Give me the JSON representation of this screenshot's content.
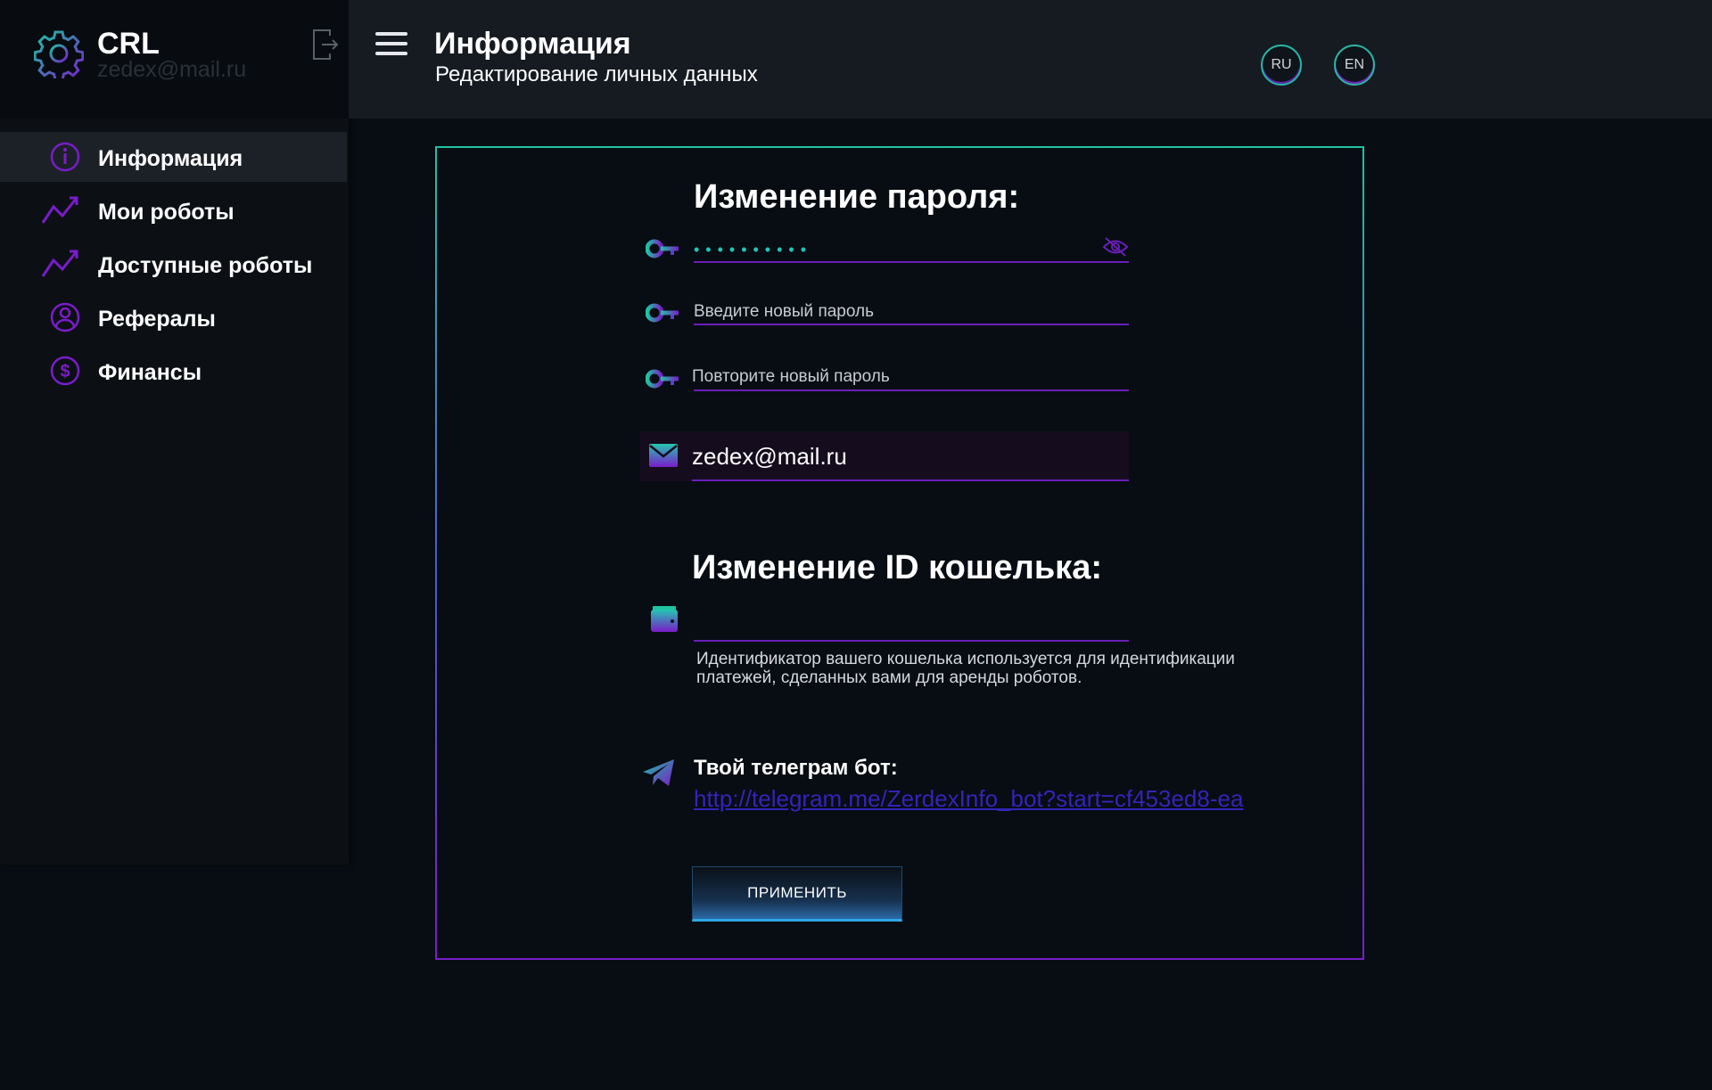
{
  "brand": {
    "name": "CRL",
    "email": "zedex@mail.ru"
  },
  "sidebar": {
    "items": [
      {
        "label": "Информация",
        "icon": "info-icon",
        "active": true
      },
      {
        "label": "Мои роботы",
        "icon": "trend-icon",
        "active": false
      },
      {
        "label": "Доступные роботы",
        "icon": "trend-icon",
        "active": false
      },
      {
        "label": "Рефералы",
        "icon": "user-icon",
        "active": false
      },
      {
        "label": "Финансы",
        "icon": "dollar-icon",
        "active": false
      }
    ]
  },
  "header": {
    "title": "Информация",
    "subtitle": "Редактирование личных данных",
    "languages": [
      "RU",
      "EN"
    ]
  },
  "form": {
    "password_section_title": "Изменение пароля:",
    "current_password_mask": "••••••••••",
    "new_password_placeholder": "Введите новый пароль",
    "repeat_password_placeholder": "Повторите новый пароль",
    "email_value": "zedex@mail.ru",
    "wallet_section_title": "Изменение ID кошелька:",
    "wallet_value": "",
    "wallet_help": "Идентификатор вашего кошелька используется для идентификации платежей, сделанных вами для аренды роботов.",
    "telegram_title": "Твой телеграм бот:",
    "telegram_link": "http://telegram.me/ZerdexInfo_bot?start=cf453ed8-ea",
    "apply_label": "ПРИМЕНИТЬ"
  },
  "colors": {
    "accent_teal": "#1ec3a3",
    "accent_purple": "#7a1cc9",
    "link": "#3324b8",
    "background": "#070d12"
  }
}
